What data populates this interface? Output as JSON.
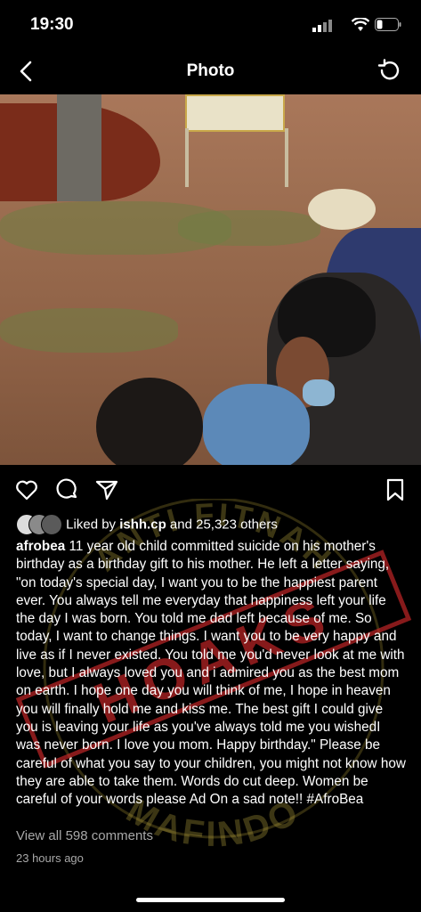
{
  "status": {
    "time": "19:30"
  },
  "nav": {
    "title": "Photo",
    "back_icon": "chevron-left-icon",
    "refresh_icon": "refresh-icon"
  },
  "post": {
    "likes_prefix": "Liked by",
    "likes_user": "ishh.cp",
    "likes_suffix": "and 25,323 others",
    "username": "afrobea",
    "caption": "11 year old child committed suicide on his mother's birthday as a birthday gift to his mother. He left a letter saying, \"on today's special day, I want you to be the happiest parent ever. You always tell me everyday that happiness left your life the day I was born. You told me dad left because of me. So today, I want to change things. I want you to be very happy and live as if I never existed. You told me you'd never look at me with love, but I always loved you and i admired you as the best mom on earth. I hope one day you will think of me, I hope in heaven you will finally hold me and kiss me. The best gift I could give you is leaving your life as you've always told me you wishedI was never born. I love you mom. Happy birthday.\" Please be careful of what you say to your children, you might not know how they are able to take them. Words do cut deep. Women be careful of your words please Ad On a sad note!! #AfroBea",
    "view_comments": "View all 598 comments",
    "time_ago": "23 hours ago"
  },
  "watermark": {
    "top_text": "ANTI FITNAH",
    "bottom_text": "MAFINDO",
    "stamp_text": "HOAKS"
  },
  "colors": {
    "background": "#000000",
    "secondary_text": "#a8a8a8",
    "stamp_red": "#d0282a"
  }
}
